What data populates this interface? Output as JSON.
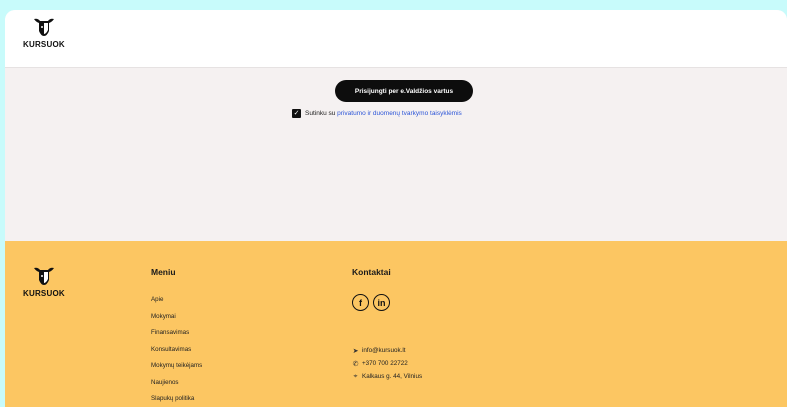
{
  "brand": {
    "name": "KURSUOK"
  },
  "main": {
    "login_button": "Prisijungti per e.Valdžios vartus",
    "consent": {
      "prefix": "Sutinku su ",
      "link": "privatumo ir duomenų tvarkymo taisyklėmis",
      "checked": true
    }
  },
  "footer": {
    "menu_title": "Meniu",
    "menu_items": [
      "Apie",
      "Mokymai",
      "Finansavimas",
      "Konsultavimas",
      "Mokymų teikėjams",
      "Naujienos",
      "Slapukų politika"
    ],
    "contacts_title": "Kontaktai",
    "socials": [
      {
        "label": "f",
        "icon": "facebook-icon"
      },
      {
        "label": "in",
        "icon": "linkedin-icon"
      }
    ],
    "email": "info@kursuok.lt",
    "phone": "+370 700 22722",
    "address": "Kalkaus g. 44, Vilnius"
  },
  "colors": {
    "page_bg": "#c8fbfb",
    "content_bg": "#f5f1f1",
    "footer_bg": "#fcc662",
    "button_bg": "#0d0d0d",
    "link": "#2d56d8"
  }
}
